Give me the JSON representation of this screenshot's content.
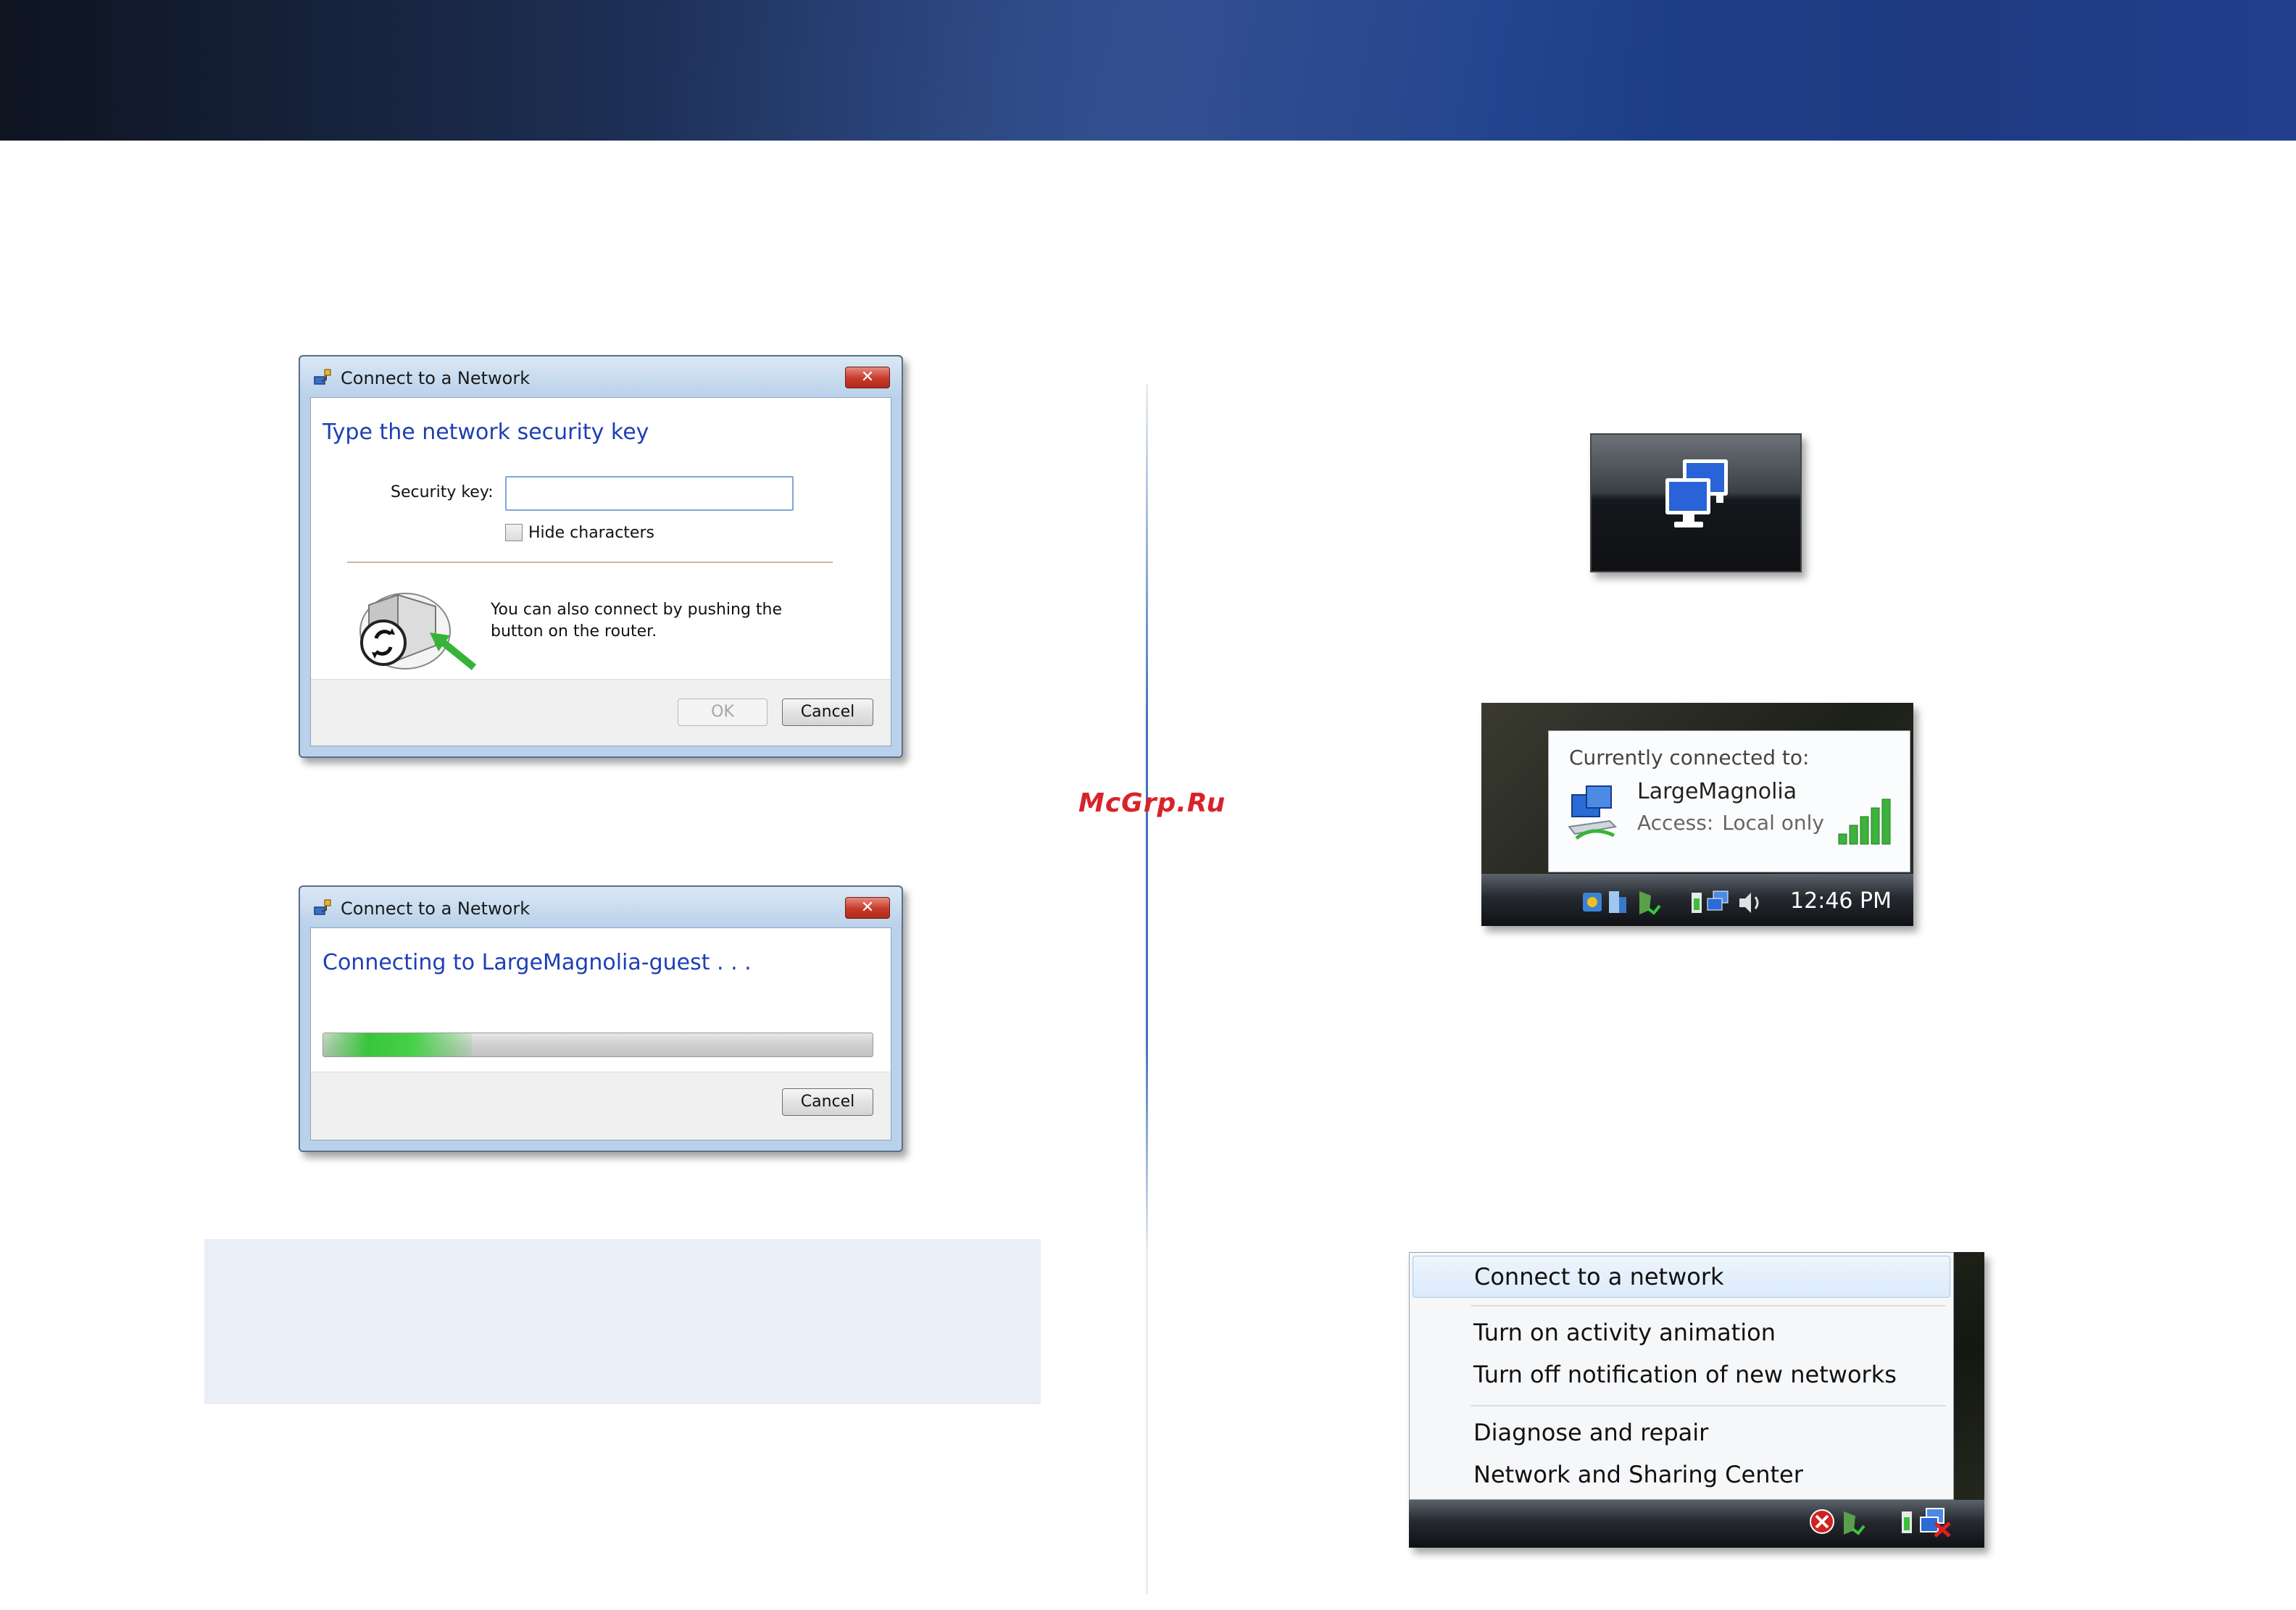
{
  "watermark": "McGrp.Ru",
  "dialog_security": {
    "title": "Connect to a Network",
    "close_glyph": "✕",
    "heading": "Type the network security key",
    "security_key_label": "Security key:",
    "security_key_value": "",
    "hide_characters_label": "Hide characters",
    "hide_characters_checked": false,
    "router_hint": "You can also connect by pushing the button on the router.",
    "ok_label": "OK",
    "cancel_label": "Cancel"
  },
  "dialog_connecting": {
    "title": "Connect to a Network",
    "close_glyph": "✕",
    "heading": "Connecting to LargeMagnolia-guest . . .",
    "progress": 0.27,
    "cancel_label": "Cancel"
  },
  "tray_icon": {
    "icon": "network-monitors-icon"
  },
  "connected_popup": {
    "title": "Currently connected to:",
    "network_name": "LargeMagnolia",
    "access_label": "Access:",
    "access_value": "Local only",
    "clock": "12:46 PM",
    "signal_bars": 5
  },
  "context_menu": {
    "items": [
      {
        "label": "Connect to a network",
        "highlighted": true
      },
      {
        "label": "Turn on activity animation"
      },
      {
        "label": "Turn off notification of new networks"
      },
      {
        "label": "Diagnose and repair"
      },
      {
        "label": "Network and Sharing Center"
      }
    ]
  },
  "colors": {
    "banner": "#1f3f8a",
    "heading_blue": "#1e3fb4",
    "watermark_red": "#d8232a",
    "note_bg": "#e9eef7",
    "progress_green": "#39c53b"
  }
}
